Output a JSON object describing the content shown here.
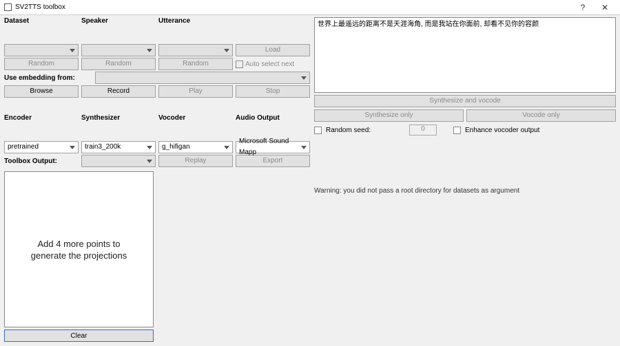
{
  "window": {
    "title": "SV2TTS toolbox",
    "help": "?",
    "close": "✕"
  },
  "left": {
    "headers": {
      "dataset": "Dataset",
      "speaker": "Speaker",
      "utterance": "Utterance"
    },
    "load": "Load",
    "random": "Random",
    "auto_select_next": "Auto select next",
    "use_embedding_from": "Use embedding from:",
    "browse": "Browse",
    "record": "Record",
    "play": "Play",
    "stop": "Stop",
    "headers2": {
      "encoder": "Encoder",
      "synthesizer": "Synthesizer",
      "vocoder": "Vocoder",
      "audio_output": "Audio Output"
    },
    "encoder_val": "pretrained",
    "synth_val": "train3_200k",
    "vocoder_val": "g_hifigan",
    "audio_out_val": "Microsoft Sound Mapp",
    "toolbox_output": "Toolbox Output:",
    "replay": "Replay",
    "export": "Export",
    "canvas_hint": "Add 4 more points to\ngenerate the projections",
    "clear": "Clear"
  },
  "right": {
    "text_input": "世界上最遥远的距离不是天涯海角, 而是我站在你面前, 却看不见你的容颜",
    "synth_and_vocode": "Synthesize and vocode",
    "synth_only": "Synthesize only",
    "vocode_only": "Vocode only",
    "random_seed_label": "Random seed:",
    "random_seed_value": "0",
    "enhance_label": "Enhance vocoder output",
    "warning": "Warning: you did not pass a root directory for datasets as argument"
  }
}
